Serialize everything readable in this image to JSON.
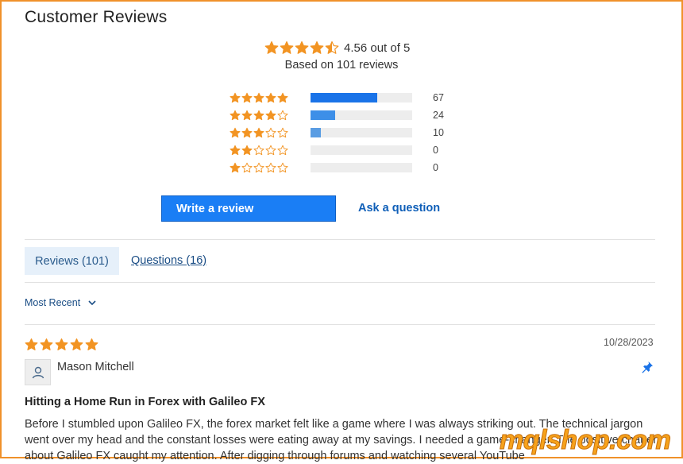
{
  "header": {
    "title": "Customer Reviews"
  },
  "summary": {
    "rating": 4.56,
    "rating_text": "4.56 out of 5",
    "based_on": "Based on 101 reviews",
    "star_color": "#f29423"
  },
  "distribution": [
    {
      "stars": 5,
      "count": "67",
      "fraction": 0.66,
      "bar_color": "#1a73e8"
    },
    {
      "stars": 4,
      "count": "24",
      "fraction": 0.24,
      "bar_color": "#3d8fe8"
    },
    {
      "stars": 3,
      "count": "10",
      "fraction": 0.1,
      "bar_color": "#5a9de3"
    },
    {
      "stars": 2,
      "count": "0",
      "fraction": 0.0,
      "bar_color": "#5a9de3"
    },
    {
      "stars": 1,
      "count": "0",
      "fraction": 0.0,
      "bar_color": "#5a9de3"
    }
  ],
  "actions": {
    "write_review": "Write a review",
    "ask_question": "Ask a question"
  },
  "tabs": [
    {
      "label": "Reviews (101)",
      "active": true
    },
    {
      "label": "Questions (16)",
      "active": false
    }
  ],
  "sort": {
    "label": "Most Recent"
  },
  "review": {
    "rating": 5,
    "date": "10/28/2023",
    "author": "Mason Mitchell",
    "title": "Hitting a Home Run in Forex with Galileo FX",
    "body": "Before I stumbled upon Galileo FX, the forex market felt like a game where I was always striking out. The technical jargon went over my head and the constant losses were eating away at my savings. I needed a game-changer. The positive chatter about Galileo FX caught my attention. After digging through forums and watching several YouTube"
  },
  "watermark": {
    "text": "mqlshop.com"
  }
}
